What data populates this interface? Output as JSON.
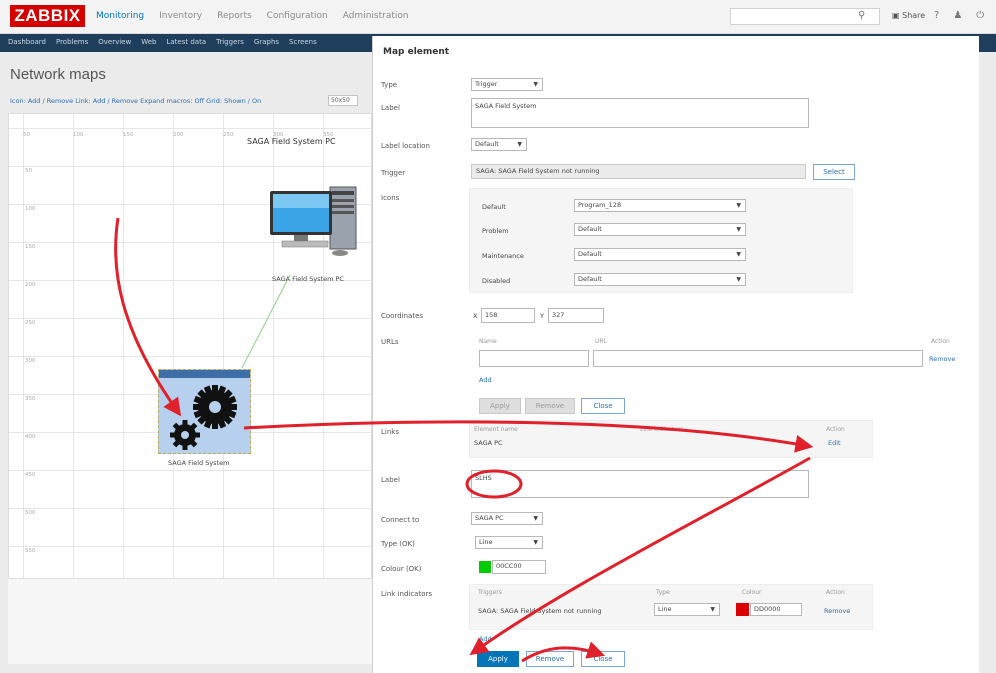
{
  "app": {
    "logo": "ZABBIX",
    "top_menu": [
      "Monitoring",
      "Inventory",
      "Reports",
      "Configuration",
      "Administration"
    ],
    "share_label": "Share",
    "icons": [
      "search-icon",
      "help-icon",
      "user-icon",
      "power-icon"
    ]
  },
  "subnav": [
    "Dashboard",
    "Problems",
    "Overview",
    "Web",
    "Latest data",
    "Triggers",
    "Graphs",
    "Screens"
  ],
  "page": {
    "title": "Network maps",
    "edit_bar": "Icon: Add / Remove  Link: Add / Remove  Expand macros: Off  Grid: Shown / On",
    "grid_size": "50x50"
  },
  "map": {
    "title": "SAGA Field System PC",
    "host_label": "SAGA Field System PC",
    "element_label": "SAGA Field System",
    "col_labels": [
      "50",
      "100",
      "150",
      "200",
      "250",
      "300",
      "350"
    ],
    "row_labels": [
      "50",
      "100",
      "150",
      "200",
      "250",
      "300",
      "350",
      "400",
      "450",
      "500",
      "550"
    ]
  },
  "dialog": {
    "title": "Map element",
    "type_label": "Type",
    "type_value": "Trigger",
    "label_label": "Label",
    "label_value": "SAGA Field System",
    "label_location_label": "Label location",
    "label_location_value": "Default",
    "trigger_label": "Trigger",
    "trigger_value": "SAGA: SAGA Field System not running",
    "select_button": "Select",
    "icons_label": "Icons",
    "icons": [
      {
        "label": "Default",
        "value": "Program_128"
      },
      {
        "label": "Problem",
        "value": "Default"
      },
      {
        "label": "Maintenance",
        "value": "Default"
      },
      {
        "label": "Disabled",
        "value": "Default"
      }
    ],
    "coordinates_label": "Coordinates",
    "x_label": "X",
    "x_value": "158",
    "y_label": "Y",
    "y_value": "327",
    "urls_label": "URLs",
    "urls_name_header": "Name",
    "urls_url_header": "URL",
    "urls_action_header": "Action",
    "remove_label": "Remove",
    "add_label": "Add",
    "apply_label": "Apply",
    "close_label": "Close",
    "links_label": "Links",
    "links_element_header": "Element name",
    "links_indicators_header": "Link indicators",
    "links_action_header": "Action",
    "links_element_value": "SAGA PC",
    "links_edit_label": "Edit",
    "link_label_label": "Label",
    "link_label_value": "SLHS",
    "connect_to_label": "Connect to",
    "connect_to_value": "SAGA PC",
    "type_ok_label": "Type (OK)",
    "type_ok_value": "Line",
    "colour_ok_label": "Colour (OK)",
    "colour_ok_value": "00CC00",
    "colour_ok_hex": "#00cc00",
    "link_indicators_label": "Link indicators",
    "ind_trigger_header": "Triggers",
    "ind_type_header": "Type",
    "ind_colour_header": "Colour",
    "ind_action_header": "Action",
    "ind_trigger_value": "SAGA: SAGA Field System not running",
    "ind_type_value": "Line",
    "ind_colour_value": "DD0000",
    "ind_colour_hex": "#dd0000",
    "ind_add_label": "Add",
    "bottom_apply": "Apply",
    "bottom_remove": "Remove",
    "bottom_close": "Close"
  },
  "colors": {
    "accent": "#0275b8",
    "logo_red": "#d40000",
    "annotation_red": "#e0202a",
    "nav_bg": "#1f3e5c"
  }
}
